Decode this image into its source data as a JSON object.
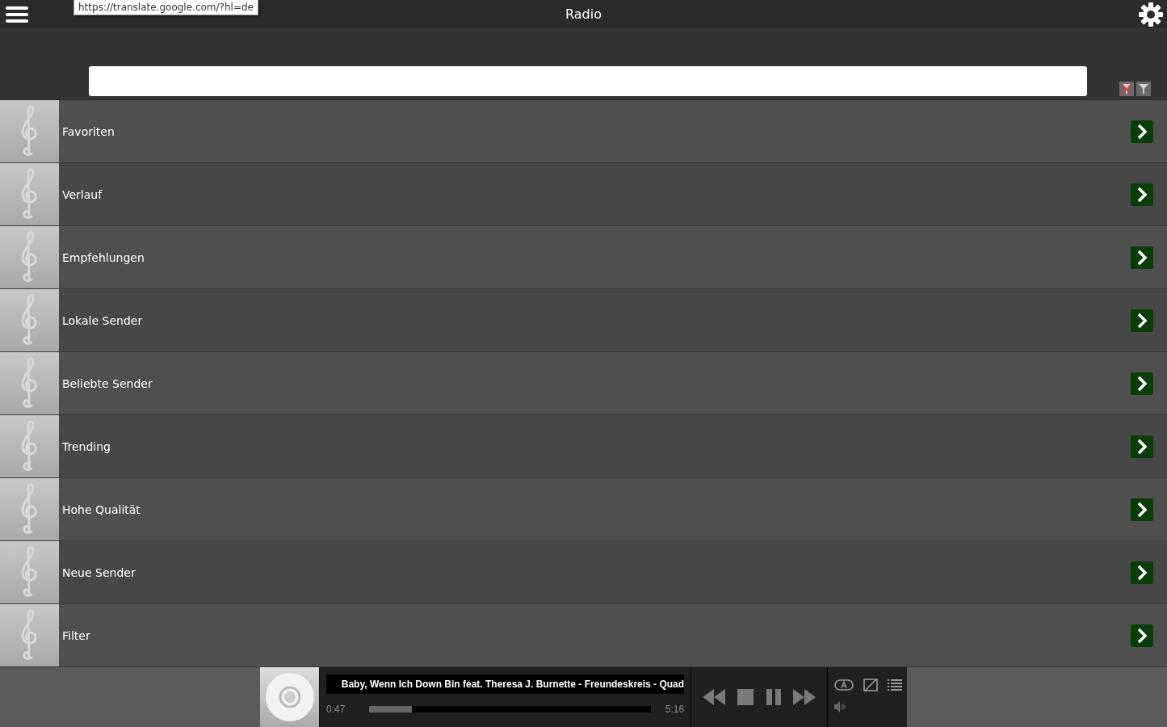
{
  "header": {
    "title": "Radio"
  },
  "tooltip": {
    "url": "https://translate.google.com/?hl=de"
  },
  "categories": [
    {
      "label": "Favoriten"
    },
    {
      "label": "Verlauf"
    },
    {
      "label": "Empfehlungen"
    },
    {
      "label": "Lokale Sender"
    },
    {
      "label": "Beliebte Sender"
    },
    {
      "label": "Trending"
    },
    {
      "label": "Hohe Qualität"
    },
    {
      "label": "Neue Sender"
    },
    {
      "label": "Filter"
    }
  ],
  "player": {
    "track": "Baby, Wenn Ich Down Bin feat. Theresa J. Burnette - Freundeskreis - Quad",
    "elapsed": "0:47",
    "duration": "5:16",
    "level": 0.15
  }
}
